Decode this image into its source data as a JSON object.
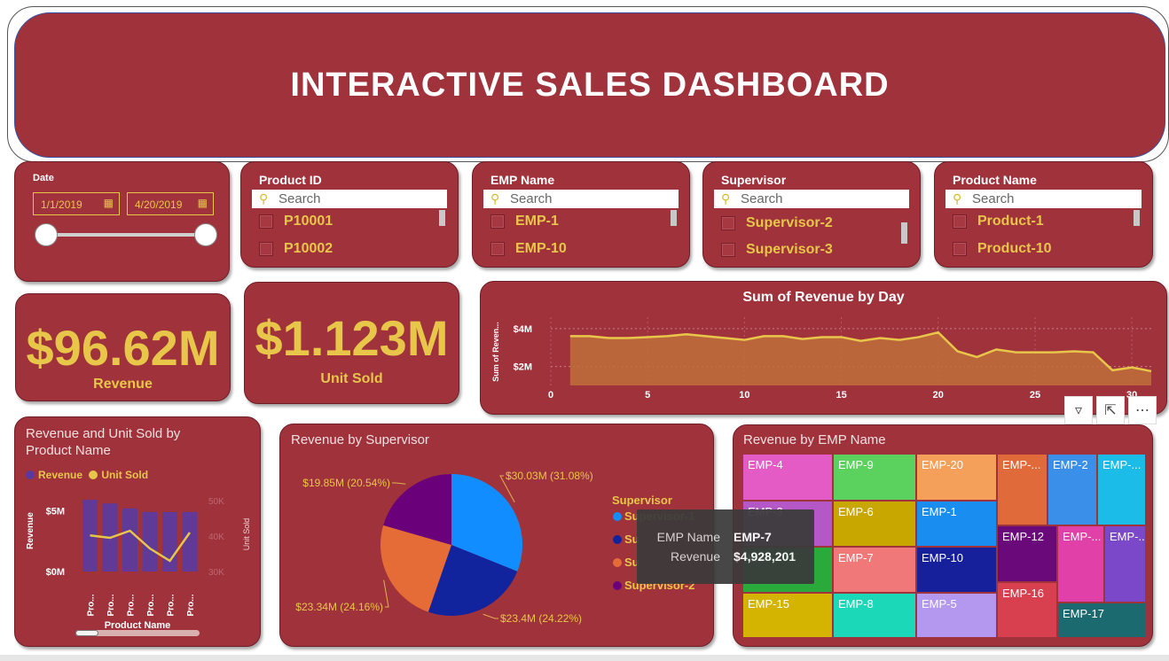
{
  "header": {
    "title": "INTERACTIVE SALES DASHBOARD"
  },
  "date_slicer": {
    "label": "Date",
    "start": "1/1/2019",
    "end": "4/20/2019",
    "slider_start_fraction": 0,
    "slider_end_fraction": 1
  },
  "slicers": [
    {
      "title": "Product ID",
      "search_placeholder": "Search",
      "items": [
        "P10001",
        "P10002"
      ]
    },
    {
      "title": "EMP Name",
      "search_placeholder": "Search",
      "items": [
        "EMP-1",
        "EMP-10"
      ]
    },
    {
      "title": "Supervisor",
      "search_placeholder": "Search",
      "items": [
        "Supervisor-2",
        "Supervisor-3"
      ]
    },
    {
      "title": "Product Name",
      "search_placeholder": "Search",
      "items": [
        "Product-1",
        "Product-10"
      ]
    }
  ],
  "kpis": [
    {
      "value": "$96.62M",
      "label": "Revenue"
    },
    {
      "value": "$1.123M",
      "label": "Unit Sold"
    }
  ],
  "colors": {
    "card": "#a0323c",
    "accent": "#e8c64a",
    "area_fill": "#c0703a",
    "line": "#e8c64a",
    "bar": "#5a3aa0"
  },
  "chart_data": [
    {
      "type": "area",
      "title": "Sum of Revenue by Day",
      "ylabel": "Sum of Reven...",
      "xlabel": "",
      "x_ticks": [
        "0",
        "5",
        "10",
        "15",
        "20",
        "25",
        "30"
      ],
      "y_ticks": [
        "$2M",
        "$4M"
      ],
      "xlim": [
        0,
        31
      ],
      "ylim": [
        1.0,
        4.6
      ],
      "x": [
        1,
        2,
        3,
        4,
        5,
        6,
        7,
        8,
        9,
        10,
        11,
        12,
        13,
        14,
        15,
        16,
        17,
        18,
        19,
        20,
        21,
        22,
        23,
        24,
        25,
        26,
        27,
        28,
        29,
        30,
        31
      ],
      "values": [
        3.6,
        3.6,
        3.5,
        3.5,
        3.55,
        3.6,
        3.7,
        3.6,
        3.5,
        3.4,
        3.6,
        3.6,
        3.45,
        3.55,
        3.55,
        3.35,
        3.5,
        3.4,
        3.55,
        3.8,
        2.8,
        2.5,
        2.9,
        2.75,
        2.75,
        2.75,
        2.8,
        2.75,
        1.8,
        1.95,
        1.75
      ],
      "grid": true
    },
    {
      "type": "bar",
      "title": "Revenue and Unit Sold by Product Name",
      "legend": [
        "Revenue",
        "Unit Sold"
      ],
      "categories": [
        "Pro...",
        "Pro...",
        "Pro...",
        "Pro...",
        "Pro...",
        "Pro..."
      ],
      "xlabel": "Product Name",
      "ylabel": "Revenue",
      "y2label": "Unit Sold",
      "y_ticks": [
        "$0M",
        "$5M"
      ],
      "y2_ticks": [
        "30K",
        "40K",
        "50K"
      ],
      "ylim": [
        0,
        7
      ],
      "y2lim": [
        30,
        54
      ],
      "series": [
        {
          "name": "Revenue",
          "type": "bar",
          "values": [
            5.9,
            5.6,
            5.2,
            4.9,
            4.9,
            4.9
          ]
        },
        {
          "name": "Unit Sold",
          "type": "line",
          "values": [
            40.2,
            39.5,
            41.5,
            36.5,
            33.0,
            41.0
          ]
        }
      ]
    },
    {
      "type": "pie",
      "title": "Revenue by Supervisor",
      "legend_title": "Supervisor",
      "slices": [
        {
          "label": "Supervisor-1",
          "value": 30.03,
          "text": "$30.03M (31.08%)",
          "color": "#118dff"
        },
        {
          "label": "Supervisor-4",
          "value": 23.4,
          "text": "$23.4M (24.22%)",
          "color": "#12239e"
        },
        {
          "label": "Supervisor-3",
          "value": 23.34,
          "text": "$23.34M (24.16%)",
          "color": "#e66c37"
        },
        {
          "label": "Supervisor-2",
          "value": 19.85,
          "text": "$19.85M (20.54%)",
          "color": "#6b007b"
        }
      ],
      "legend_visible": [
        "Supervisor-1",
        "Su",
        "Su",
        "Supervisor-2"
      ]
    },
    {
      "type": "treemap",
      "title": "Revenue by EMP Name",
      "cells": [
        {
          "label": "EMP-4",
          "color": "#e45bc5"
        },
        {
          "label": "EMP-9",
          "color": "#5bd25e"
        },
        {
          "label": "EMP-20",
          "color": "#f5a05a"
        },
        {
          "label": "EMP-...",
          "color": "#e06a3a"
        },
        {
          "label": "EMP-2",
          "color": "#3a8fe8"
        },
        {
          "label": "EMP-...",
          "color": "#1bbde8"
        },
        {
          "label": "EMP-3",
          "color": "#b458c8"
        },
        {
          "label": "EMP-6",
          "color": "#c8a800"
        },
        {
          "label": "EMP-1",
          "color": "#1a8ef0"
        },
        {
          "label": "EMP-12",
          "color": "#6a0a7a"
        },
        {
          "label": "EMP-...",
          "color": "#e040a8"
        },
        {
          "label": "EMP-...",
          "color": "#7a48c8"
        },
        {
          "label": "EMP-7",
          "color": "#2aaa3a"
        },
        {
          "label": "EMP-7",
          "color": "#f07878"
        },
        {
          "label": "EMP-10",
          "color": "#15209a"
        },
        {
          "label": "EMP-16",
          "color": "#d84050"
        },
        {
          "label": "EMP-17",
          "color": "#1a6a70"
        },
        {
          "label": "EMP-15",
          "color": "#d4b400"
        },
        {
          "label": "EMP-8",
          "color": "#1ad8b8"
        },
        {
          "label": "EMP-5",
          "color": "#b498f0"
        }
      ]
    }
  ],
  "tooltip": {
    "key1": "EMP Name",
    "val1": "EMP-7",
    "key2": "Revenue",
    "val2": "$4,928,201"
  },
  "visual_header_icons": [
    "filter-icon",
    "focus-mode-icon",
    "more-options-icon"
  ]
}
